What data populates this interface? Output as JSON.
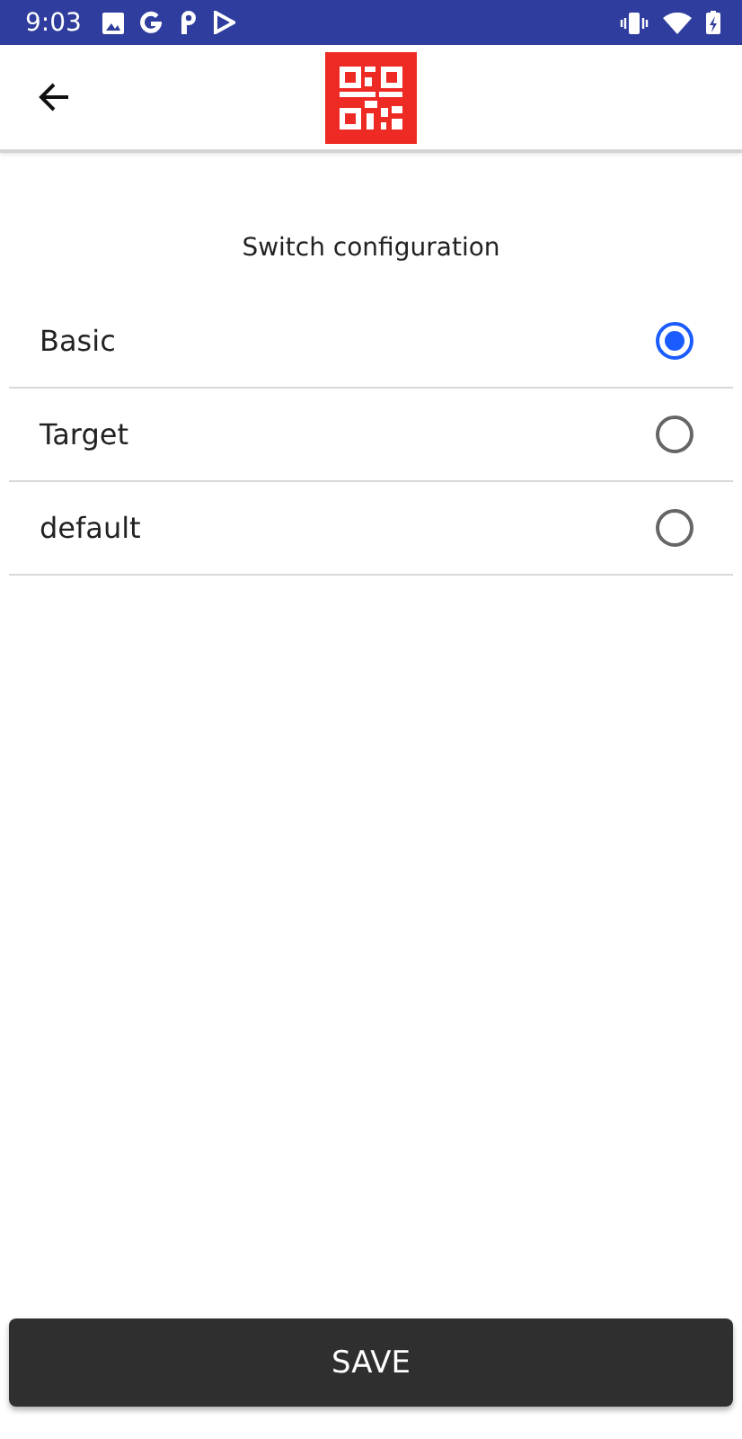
{
  "status_bar": {
    "time": "9:03"
  },
  "title": "Switch configuration",
  "options": [
    {
      "label": "Basic",
      "selected": true
    },
    {
      "label": "Target",
      "selected": false
    },
    {
      "label": "default",
      "selected": false
    }
  ],
  "save_button": "SAVE"
}
